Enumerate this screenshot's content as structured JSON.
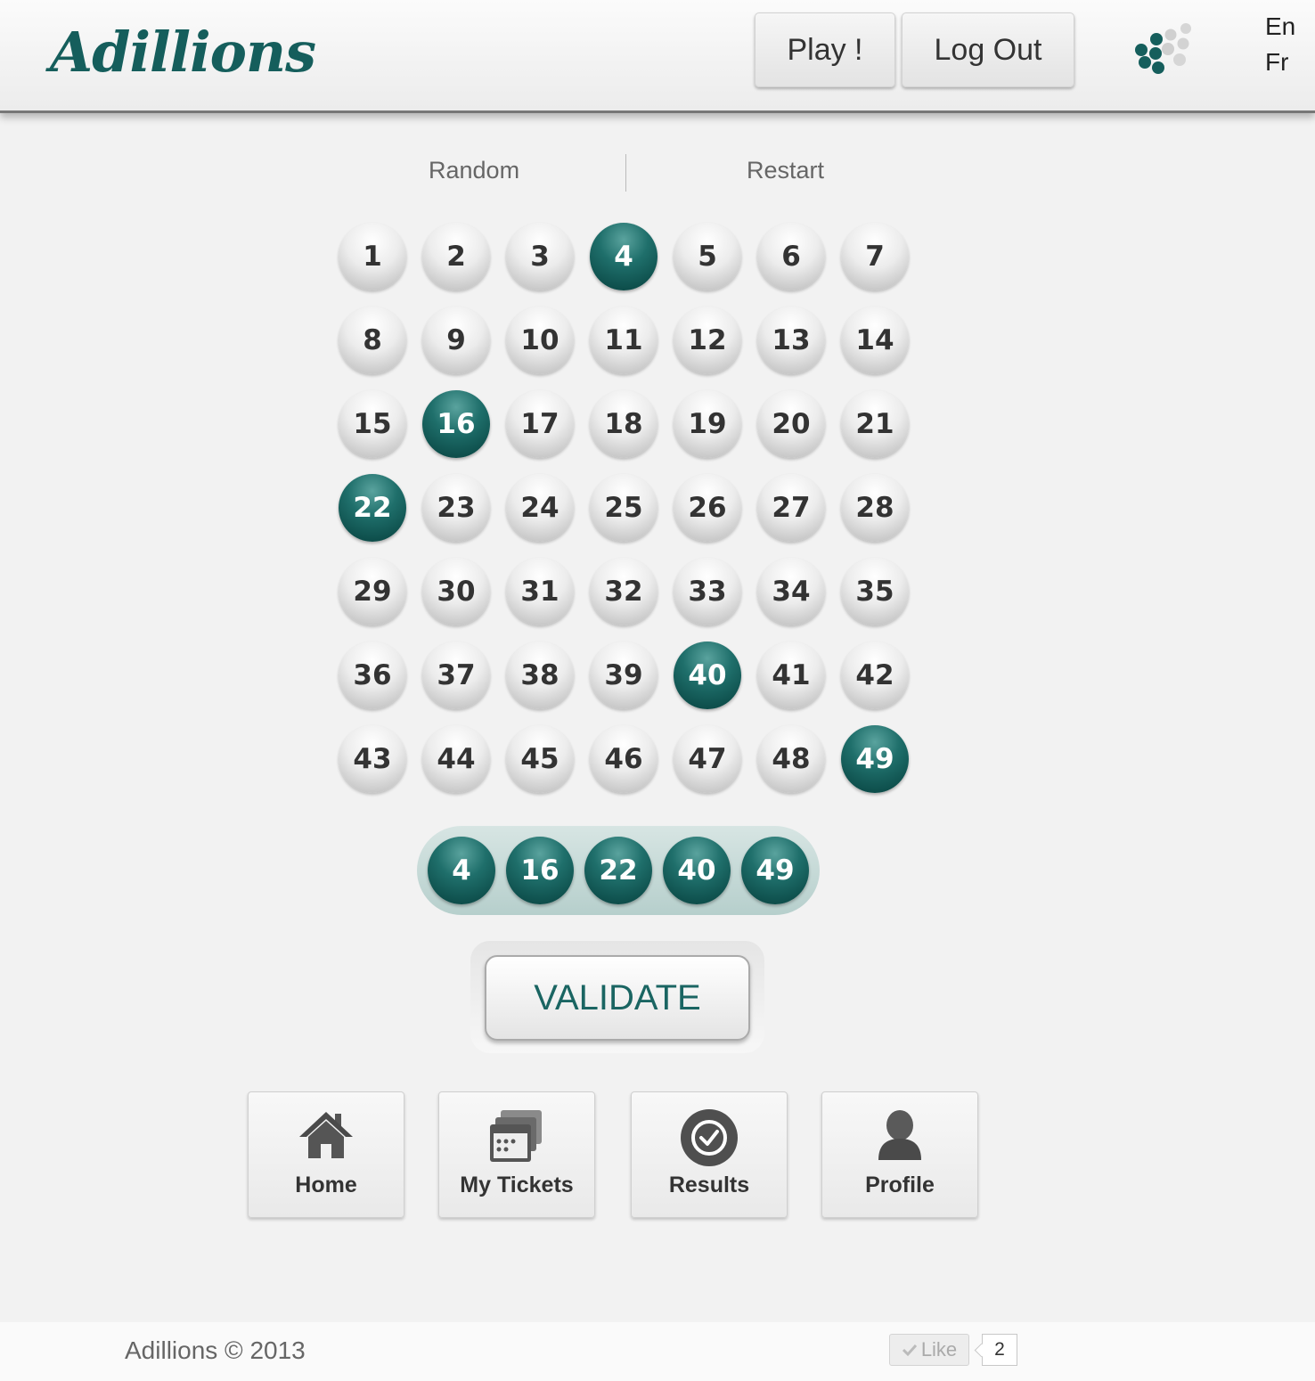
{
  "header": {
    "logo": "Adillions",
    "play_label": "Play !",
    "logout_label": "Log Out",
    "loading_icon": "dots-loader-icon",
    "languages": [
      "En",
      "Fr"
    ]
  },
  "actions": {
    "random_label": "Random",
    "restart_label": "Restart"
  },
  "numbers": [
    "1",
    "2",
    "3",
    "4",
    "5",
    "6",
    "7",
    "8",
    "9",
    "10",
    "11",
    "12",
    "13",
    "14",
    "15",
    "16",
    "17",
    "18",
    "19",
    "20",
    "21",
    "22",
    "23",
    "24",
    "25",
    "26",
    "27",
    "28",
    "29",
    "30",
    "31",
    "32",
    "33",
    "34",
    "35",
    "36",
    "37",
    "38",
    "39",
    "40",
    "41",
    "42",
    "43",
    "44",
    "45",
    "46",
    "47",
    "48",
    "49"
  ],
  "selected": [
    "4",
    "16",
    "22",
    "40",
    "49"
  ],
  "validate_label": "VALIDATE",
  "nav": [
    {
      "label": "Home",
      "icon": "home-icon"
    },
    {
      "label": "My Tickets",
      "icon": "tickets-icon"
    },
    {
      "label": "Results",
      "icon": "check-circle-icon"
    },
    {
      "label": "Profile",
      "icon": "user-icon"
    }
  ],
  "footer": {
    "copyright": "Adillions © 2013",
    "like_label": "Like",
    "like_count": "2"
  },
  "colors": {
    "brand": "#155e5c",
    "selected_ball": "#1f6f6b",
    "tray": "#c4d9d6"
  }
}
